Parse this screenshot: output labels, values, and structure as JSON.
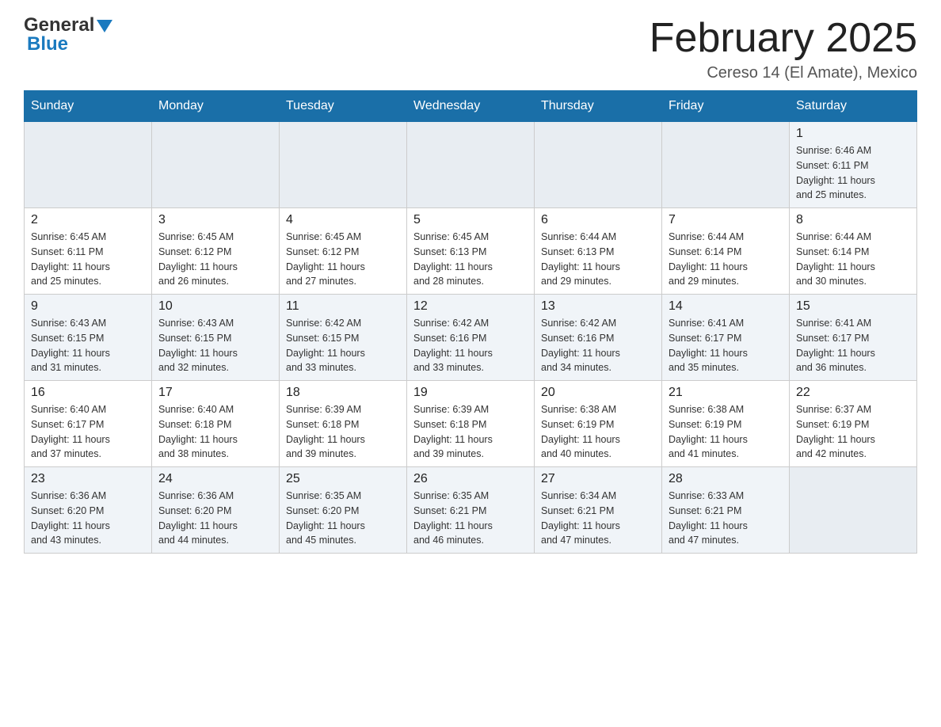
{
  "logo": {
    "line1": "General",
    "triangle": "▲",
    "line2": "Blue"
  },
  "title": {
    "month_year": "February 2025",
    "location": "Cereso 14 (El Amate), Mexico"
  },
  "weekdays": [
    "Sunday",
    "Monday",
    "Tuesday",
    "Wednesday",
    "Thursday",
    "Friday",
    "Saturday"
  ],
  "weeks": [
    {
      "days": [
        {
          "date": "",
          "info": ""
        },
        {
          "date": "",
          "info": ""
        },
        {
          "date": "",
          "info": ""
        },
        {
          "date": "",
          "info": ""
        },
        {
          "date": "",
          "info": ""
        },
        {
          "date": "",
          "info": ""
        },
        {
          "date": "1",
          "info": "Sunrise: 6:46 AM\nSunset: 6:11 PM\nDaylight: 11 hours\nand 25 minutes."
        }
      ]
    },
    {
      "days": [
        {
          "date": "2",
          "info": "Sunrise: 6:45 AM\nSunset: 6:11 PM\nDaylight: 11 hours\nand 25 minutes."
        },
        {
          "date": "3",
          "info": "Sunrise: 6:45 AM\nSunset: 6:12 PM\nDaylight: 11 hours\nand 26 minutes."
        },
        {
          "date": "4",
          "info": "Sunrise: 6:45 AM\nSunset: 6:12 PM\nDaylight: 11 hours\nand 27 minutes."
        },
        {
          "date": "5",
          "info": "Sunrise: 6:45 AM\nSunset: 6:13 PM\nDaylight: 11 hours\nand 28 minutes."
        },
        {
          "date": "6",
          "info": "Sunrise: 6:44 AM\nSunset: 6:13 PM\nDaylight: 11 hours\nand 29 minutes."
        },
        {
          "date": "7",
          "info": "Sunrise: 6:44 AM\nSunset: 6:14 PM\nDaylight: 11 hours\nand 29 minutes."
        },
        {
          "date": "8",
          "info": "Sunrise: 6:44 AM\nSunset: 6:14 PM\nDaylight: 11 hours\nand 30 minutes."
        }
      ]
    },
    {
      "days": [
        {
          "date": "9",
          "info": "Sunrise: 6:43 AM\nSunset: 6:15 PM\nDaylight: 11 hours\nand 31 minutes."
        },
        {
          "date": "10",
          "info": "Sunrise: 6:43 AM\nSunset: 6:15 PM\nDaylight: 11 hours\nand 32 minutes."
        },
        {
          "date": "11",
          "info": "Sunrise: 6:42 AM\nSunset: 6:15 PM\nDaylight: 11 hours\nand 33 minutes."
        },
        {
          "date": "12",
          "info": "Sunrise: 6:42 AM\nSunset: 6:16 PM\nDaylight: 11 hours\nand 33 minutes."
        },
        {
          "date": "13",
          "info": "Sunrise: 6:42 AM\nSunset: 6:16 PM\nDaylight: 11 hours\nand 34 minutes."
        },
        {
          "date": "14",
          "info": "Sunrise: 6:41 AM\nSunset: 6:17 PM\nDaylight: 11 hours\nand 35 minutes."
        },
        {
          "date": "15",
          "info": "Sunrise: 6:41 AM\nSunset: 6:17 PM\nDaylight: 11 hours\nand 36 minutes."
        }
      ]
    },
    {
      "days": [
        {
          "date": "16",
          "info": "Sunrise: 6:40 AM\nSunset: 6:17 PM\nDaylight: 11 hours\nand 37 minutes."
        },
        {
          "date": "17",
          "info": "Sunrise: 6:40 AM\nSunset: 6:18 PM\nDaylight: 11 hours\nand 38 minutes."
        },
        {
          "date": "18",
          "info": "Sunrise: 6:39 AM\nSunset: 6:18 PM\nDaylight: 11 hours\nand 39 minutes."
        },
        {
          "date": "19",
          "info": "Sunrise: 6:39 AM\nSunset: 6:18 PM\nDaylight: 11 hours\nand 39 minutes."
        },
        {
          "date": "20",
          "info": "Sunrise: 6:38 AM\nSunset: 6:19 PM\nDaylight: 11 hours\nand 40 minutes."
        },
        {
          "date": "21",
          "info": "Sunrise: 6:38 AM\nSunset: 6:19 PM\nDaylight: 11 hours\nand 41 minutes."
        },
        {
          "date": "22",
          "info": "Sunrise: 6:37 AM\nSunset: 6:19 PM\nDaylight: 11 hours\nand 42 minutes."
        }
      ]
    },
    {
      "days": [
        {
          "date": "23",
          "info": "Sunrise: 6:36 AM\nSunset: 6:20 PM\nDaylight: 11 hours\nand 43 minutes."
        },
        {
          "date": "24",
          "info": "Sunrise: 6:36 AM\nSunset: 6:20 PM\nDaylight: 11 hours\nand 44 minutes."
        },
        {
          "date": "25",
          "info": "Sunrise: 6:35 AM\nSunset: 6:20 PM\nDaylight: 11 hours\nand 45 minutes."
        },
        {
          "date": "26",
          "info": "Sunrise: 6:35 AM\nSunset: 6:21 PM\nDaylight: 11 hours\nand 46 minutes."
        },
        {
          "date": "27",
          "info": "Sunrise: 6:34 AM\nSunset: 6:21 PM\nDaylight: 11 hours\nand 47 minutes."
        },
        {
          "date": "28",
          "info": "Sunrise: 6:33 AM\nSunset: 6:21 PM\nDaylight: 11 hours\nand 47 minutes."
        },
        {
          "date": "",
          "info": ""
        }
      ]
    }
  ]
}
